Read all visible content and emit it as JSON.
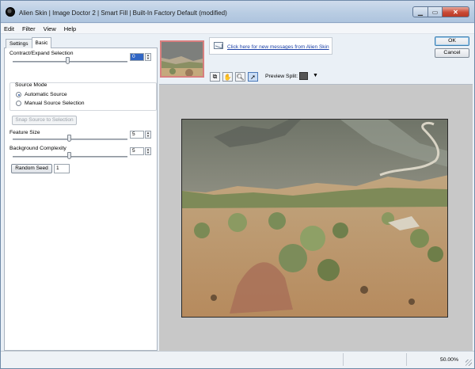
{
  "window": {
    "title": "Alien Skin | Image Doctor 2 | Smart Fill | Built-In Factory Default (modified)"
  },
  "menu": [
    "Edit",
    "Filter",
    "View",
    "Help"
  ],
  "tabs": {
    "settings": "Settings",
    "basic": "Basic"
  },
  "contract_expand": {
    "label": "Contract/Expand Selection",
    "value": "0"
  },
  "source_mode": {
    "label": "Source Mode",
    "options": [
      "Automatic Source",
      "Manual Source Selection"
    ],
    "selected": "Automatic Source"
  },
  "snap_button": "Snap Source to Selection",
  "feature_size": {
    "label": "Feature Size",
    "value": "5"
  },
  "background_complexity": {
    "label": "Background Complexity",
    "value": "5"
  },
  "random_seed": {
    "button": "Random Seed",
    "value": "1"
  },
  "messages": {
    "link": "Click here for new messages from Alien Skin"
  },
  "preview": {
    "label": "Preview Split:"
  },
  "buttons": {
    "ok": "OK",
    "cancel": "Cancel"
  },
  "status": {
    "zoom": "50.00%"
  },
  "icons": [
    "app-icon",
    "minimize-icon",
    "maximize-icon",
    "close-icon",
    "message-icon",
    "compare-icon",
    "hand-icon",
    "zoom-icon",
    "pointer-icon",
    "chevron-down-icon"
  ]
}
